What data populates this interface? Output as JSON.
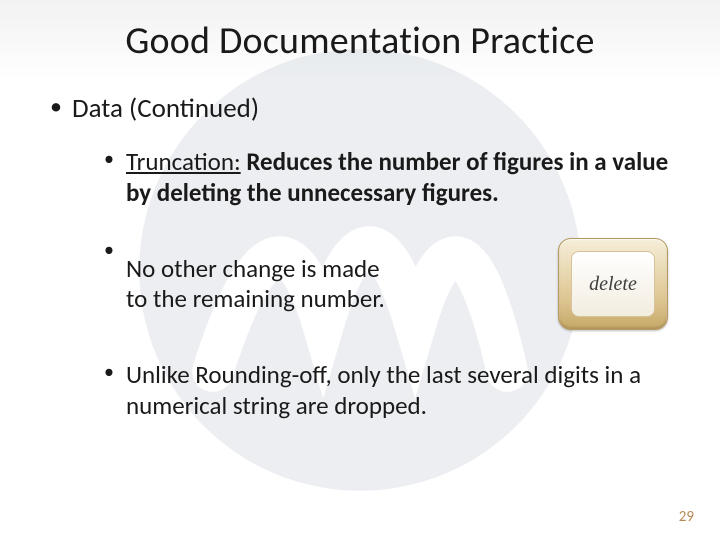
{
  "title": "Good Documentation Practice",
  "level1_label": "Data (Continued)",
  "bullets": {
    "b1": {
      "label": "Truncation:",
      "rest": " Reduces the number of figures in a value by deleting the unnecessary figures."
    },
    "b2": {
      "line1": "No other change is made",
      "line2": "to the remaining number."
    },
    "b3": "Unlike Rounding-off, only the last several digits in a numerical string are dropped."
  },
  "key_label": "delete",
  "page_number": "29"
}
